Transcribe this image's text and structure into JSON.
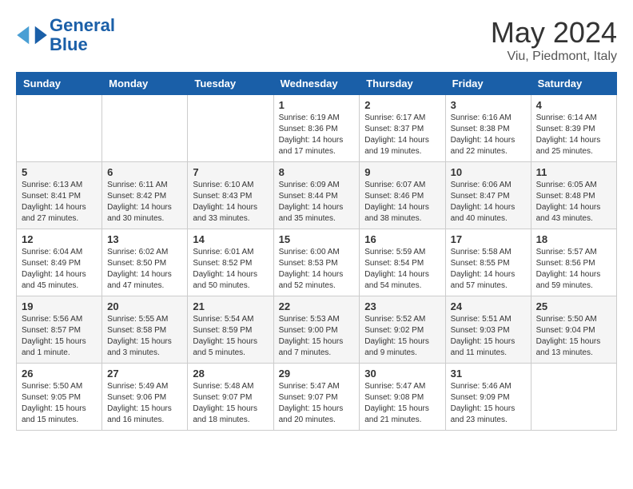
{
  "header": {
    "logo_line1": "General",
    "logo_line2": "Blue",
    "month": "May 2024",
    "location": "Viu, Piedmont, Italy"
  },
  "weekdays": [
    "Sunday",
    "Monday",
    "Tuesday",
    "Wednesday",
    "Thursday",
    "Friday",
    "Saturday"
  ],
  "weeks": [
    [
      {
        "day": "",
        "content": ""
      },
      {
        "day": "",
        "content": ""
      },
      {
        "day": "",
        "content": ""
      },
      {
        "day": "1",
        "content": "Sunrise: 6:19 AM\nSunset: 8:36 PM\nDaylight: 14 hours\nand 17 minutes."
      },
      {
        "day": "2",
        "content": "Sunrise: 6:17 AM\nSunset: 8:37 PM\nDaylight: 14 hours\nand 19 minutes."
      },
      {
        "day": "3",
        "content": "Sunrise: 6:16 AM\nSunset: 8:38 PM\nDaylight: 14 hours\nand 22 minutes."
      },
      {
        "day": "4",
        "content": "Sunrise: 6:14 AM\nSunset: 8:39 PM\nDaylight: 14 hours\nand 25 minutes."
      }
    ],
    [
      {
        "day": "5",
        "content": "Sunrise: 6:13 AM\nSunset: 8:41 PM\nDaylight: 14 hours\nand 27 minutes."
      },
      {
        "day": "6",
        "content": "Sunrise: 6:11 AM\nSunset: 8:42 PM\nDaylight: 14 hours\nand 30 minutes."
      },
      {
        "day": "7",
        "content": "Sunrise: 6:10 AM\nSunset: 8:43 PM\nDaylight: 14 hours\nand 33 minutes."
      },
      {
        "day": "8",
        "content": "Sunrise: 6:09 AM\nSunset: 8:44 PM\nDaylight: 14 hours\nand 35 minutes."
      },
      {
        "day": "9",
        "content": "Sunrise: 6:07 AM\nSunset: 8:46 PM\nDaylight: 14 hours\nand 38 minutes."
      },
      {
        "day": "10",
        "content": "Sunrise: 6:06 AM\nSunset: 8:47 PM\nDaylight: 14 hours\nand 40 minutes."
      },
      {
        "day": "11",
        "content": "Sunrise: 6:05 AM\nSunset: 8:48 PM\nDaylight: 14 hours\nand 43 minutes."
      }
    ],
    [
      {
        "day": "12",
        "content": "Sunrise: 6:04 AM\nSunset: 8:49 PM\nDaylight: 14 hours\nand 45 minutes."
      },
      {
        "day": "13",
        "content": "Sunrise: 6:02 AM\nSunset: 8:50 PM\nDaylight: 14 hours\nand 47 minutes."
      },
      {
        "day": "14",
        "content": "Sunrise: 6:01 AM\nSunset: 8:52 PM\nDaylight: 14 hours\nand 50 minutes."
      },
      {
        "day": "15",
        "content": "Sunrise: 6:00 AM\nSunset: 8:53 PM\nDaylight: 14 hours\nand 52 minutes."
      },
      {
        "day": "16",
        "content": "Sunrise: 5:59 AM\nSunset: 8:54 PM\nDaylight: 14 hours\nand 54 minutes."
      },
      {
        "day": "17",
        "content": "Sunrise: 5:58 AM\nSunset: 8:55 PM\nDaylight: 14 hours\nand 57 minutes."
      },
      {
        "day": "18",
        "content": "Sunrise: 5:57 AM\nSunset: 8:56 PM\nDaylight: 14 hours\nand 59 minutes."
      }
    ],
    [
      {
        "day": "19",
        "content": "Sunrise: 5:56 AM\nSunset: 8:57 PM\nDaylight: 15 hours\nand 1 minute."
      },
      {
        "day": "20",
        "content": "Sunrise: 5:55 AM\nSunset: 8:58 PM\nDaylight: 15 hours\nand 3 minutes."
      },
      {
        "day": "21",
        "content": "Sunrise: 5:54 AM\nSunset: 8:59 PM\nDaylight: 15 hours\nand 5 minutes."
      },
      {
        "day": "22",
        "content": "Sunrise: 5:53 AM\nSunset: 9:00 PM\nDaylight: 15 hours\nand 7 minutes."
      },
      {
        "day": "23",
        "content": "Sunrise: 5:52 AM\nSunset: 9:02 PM\nDaylight: 15 hours\nand 9 minutes."
      },
      {
        "day": "24",
        "content": "Sunrise: 5:51 AM\nSunset: 9:03 PM\nDaylight: 15 hours\nand 11 minutes."
      },
      {
        "day": "25",
        "content": "Sunrise: 5:50 AM\nSunset: 9:04 PM\nDaylight: 15 hours\nand 13 minutes."
      }
    ],
    [
      {
        "day": "26",
        "content": "Sunrise: 5:50 AM\nSunset: 9:05 PM\nDaylight: 15 hours\nand 15 minutes."
      },
      {
        "day": "27",
        "content": "Sunrise: 5:49 AM\nSunset: 9:06 PM\nDaylight: 15 hours\nand 16 minutes."
      },
      {
        "day": "28",
        "content": "Sunrise: 5:48 AM\nSunset: 9:07 PM\nDaylight: 15 hours\nand 18 minutes."
      },
      {
        "day": "29",
        "content": "Sunrise: 5:47 AM\nSunset: 9:07 PM\nDaylight: 15 hours\nand 20 minutes."
      },
      {
        "day": "30",
        "content": "Sunrise: 5:47 AM\nSunset: 9:08 PM\nDaylight: 15 hours\nand 21 minutes."
      },
      {
        "day": "31",
        "content": "Sunrise: 5:46 AM\nSunset: 9:09 PM\nDaylight: 15 hours\nand 23 minutes."
      },
      {
        "day": "",
        "content": ""
      }
    ]
  ]
}
